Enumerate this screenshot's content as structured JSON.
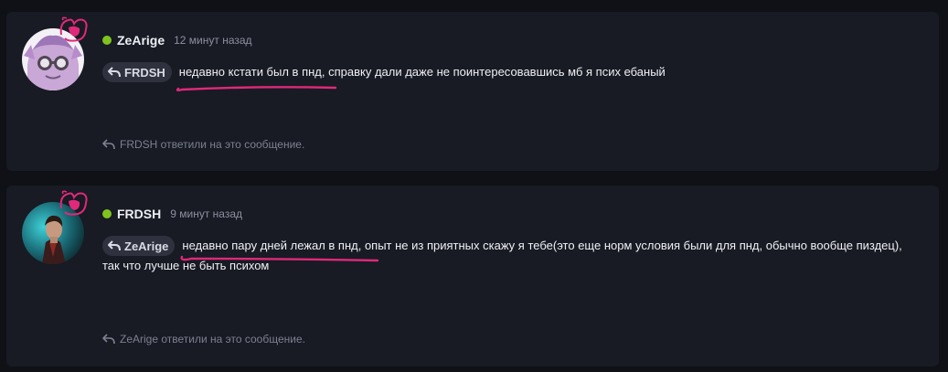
{
  "messages": [
    {
      "username": "ZeArige",
      "timestamp": "12 минут назад",
      "reply_to": "FRDSH",
      "text": "недавно кстати был в пнд, справку дали даже не поинтересовавшись мб я псих ебаный",
      "footer": "FRDSH ответили на это сообщение.",
      "status": "online"
    },
    {
      "username": "FRDSH",
      "timestamp": "9 минут назад",
      "reply_to": "ZeArige",
      "text": "недавно пару дней лежал в пнд, опыт не из приятных скажу я тебе(это еще норм условия были для пнд, обычно вообще пиздец), так что лучше не быть психом",
      "footer": "ZeArige ответили на это сообщение.",
      "status": "online"
    }
  ],
  "colors": {
    "page_background": "#0f1117",
    "card_background": "#181a24",
    "online_status": "#7fc41e",
    "annotation": "#e0297a",
    "reply_chip": "#2f323e"
  },
  "icons": {
    "reply": "reply-arrow-icon",
    "avatar_mark": "annotation-scribble-icon"
  }
}
